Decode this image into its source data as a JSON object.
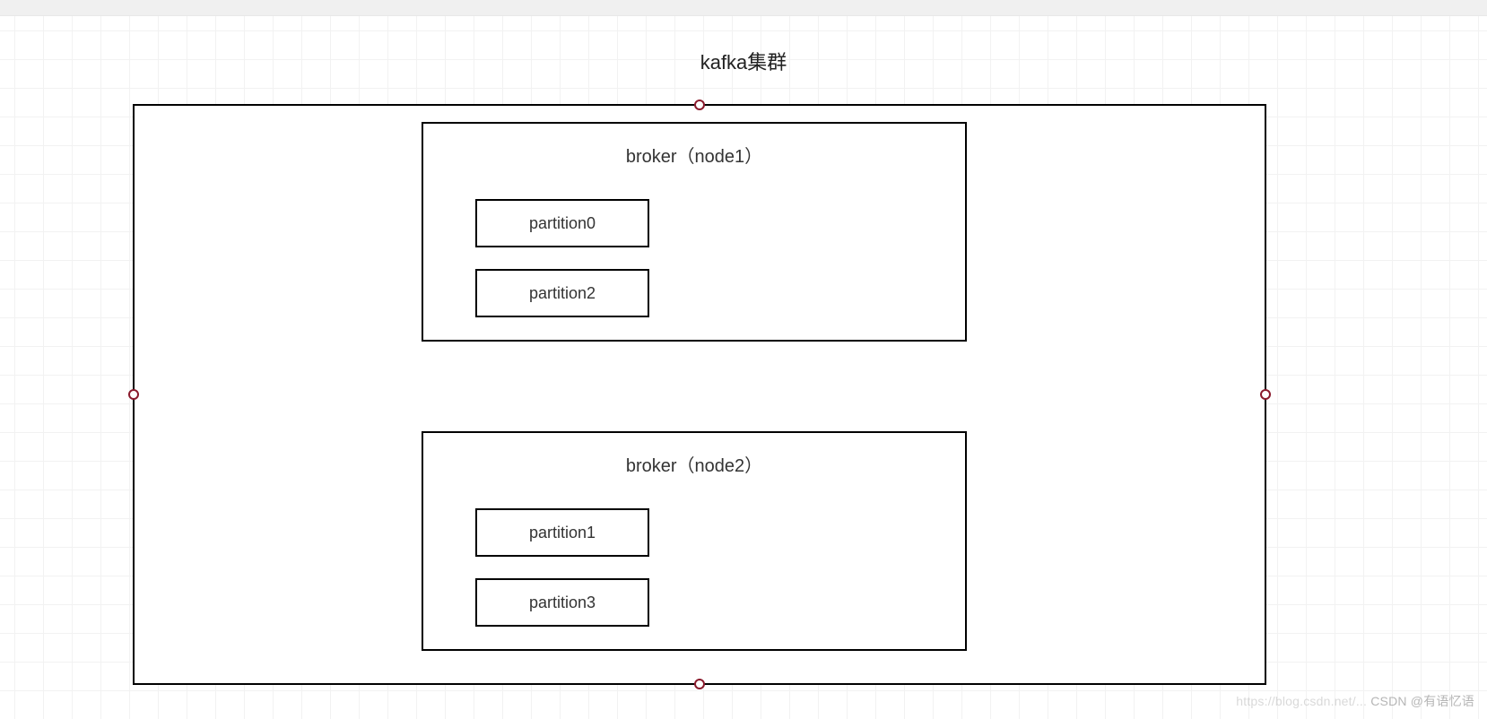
{
  "title": "kafka集群",
  "cluster": {
    "brokers": [
      {
        "label": "broker（node1）",
        "partitions": [
          "partition0",
          "partition2"
        ]
      },
      {
        "label": "broker（node2）",
        "partitions": [
          "partition1",
          "partition3"
        ]
      }
    ]
  },
  "watermark": {
    "faint": "https://blog.csdn.net/...",
    "main": "CSDN @有语忆语"
  }
}
